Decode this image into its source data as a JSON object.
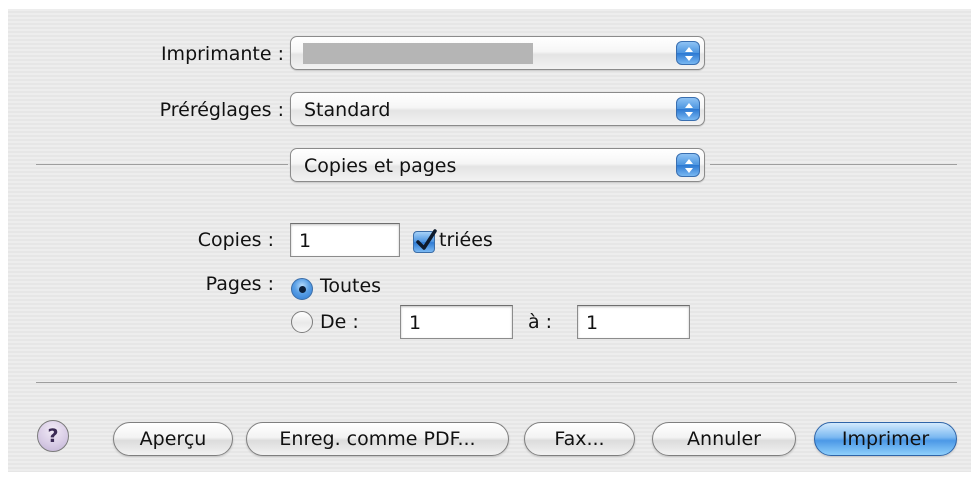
{
  "dialog": {
    "printer": {
      "label": "Imprimante :",
      "value": ""
    },
    "presets": {
      "label": "Préréglages :",
      "value": "Standard"
    },
    "section": {
      "value": "Copies et pages"
    },
    "copies": {
      "label": "Copies :",
      "value": "1",
      "collated_label": "triées",
      "collated_checked": true
    },
    "pages": {
      "label": "Pages :",
      "all_label": "Toutes",
      "range_label": "De :",
      "from_value": "1",
      "to_label": "à :",
      "to_value": "1",
      "selected": "Toutes"
    },
    "footer": {
      "help_label": "?",
      "preview_label": "Aperçu",
      "save_pdf_label": "Enreg. comme PDF...",
      "fax_label": "Fax...",
      "cancel_label": "Annuler",
      "print_label": "Imprimer"
    }
  },
  "colors": {
    "accent": "#4b98e6",
    "background": "#ececec",
    "separator": "#9e9e9e"
  }
}
